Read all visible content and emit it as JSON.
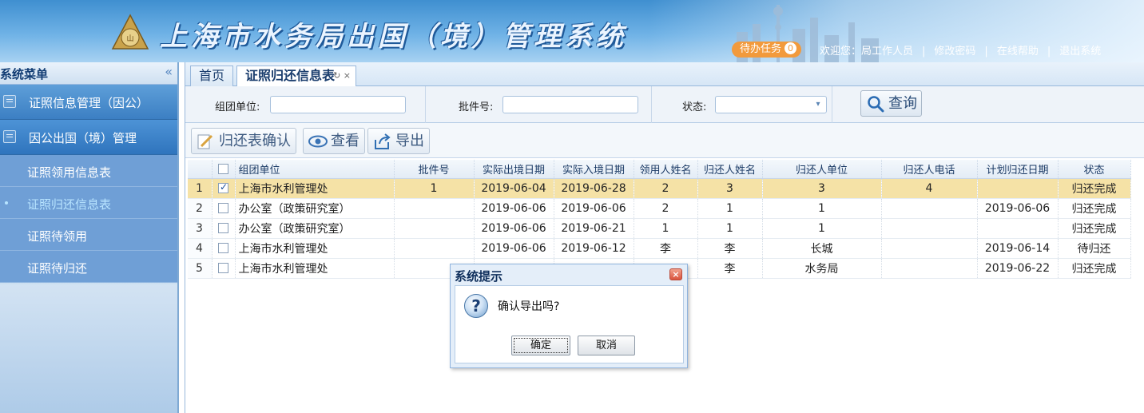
{
  "header": {
    "title": "上海市水务局出国（境）管理系统",
    "todo_label": "待办任务",
    "todo_count": "0",
    "welcome": "欢迎您：局工作人员",
    "change_password": "修改密码",
    "help": "在线帮助",
    "logout": "退出系统",
    "sep": "|"
  },
  "sidebar": {
    "title": "系统菜单",
    "collapse_icon": "«",
    "groups": [
      {
        "label": "证照信息管理（因公）"
      },
      {
        "label": "因公出国（境）管理"
      }
    ],
    "items": [
      {
        "label": "证照领用信息表"
      },
      {
        "label": "证照归还信息表"
      },
      {
        "label": "证照待领用"
      },
      {
        "label": "证照待归还"
      }
    ]
  },
  "tabs": {
    "home": "首页",
    "active": "证照归还信息表",
    "tools": "↻ ×"
  },
  "filter": {
    "org_label": "组团单位:",
    "batch_label": "批件号:",
    "status_label": "状态:",
    "query_label": "查询"
  },
  "toolbar": {
    "confirm_label": "归还表确认",
    "view_label": "查看",
    "export_label": "导出"
  },
  "table": {
    "headers": [
      "组团单位",
      "批件号",
      "实际出境日期",
      "实际入境日期",
      "领用人姓名",
      "归还人姓名",
      "归还人单位",
      "归还人电话",
      "计划归还日期",
      "状态"
    ],
    "rows": [
      {
        "n": "1",
        "checked": true,
        "org": "上海市水利管理处",
        "batch": "1",
        "out": "2019-06-04",
        "in": "2019-06-28",
        "receiver": "2",
        "returner": "3",
        "ret_org": "3",
        "phone": "4",
        "plan": "",
        "status": "归还完成"
      },
      {
        "n": "2",
        "checked": false,
        "org": "办公室（政策研究室）",
        "batch": "",
        "out": "2019-06-06",
        "in": "2019-06-06",
        "receiver": "2",
        "returner": "1",
        "ret_org": "1",
        "phone": "",
        "plan": "2019-06-06",
        "status": "归还完成"
      },
      {
        "n": "3",
        "checked": false,
        "org": "办公室（政策研究室）",
        "batch": "",
        "out": "2019-06-06",
        "in": "2019-06-21",
        "receiver": "1",
        "returner": "1",
        "ret_org": "1",
        "phone": "",
        "plan": "",
        "status": "归还完成"
      },
      {
        "n": "4",
        "checked": false,
        "org": "上海市水利管理处",
        "batch": "",
        "out": "2019-06-06",
        "in": "2019-06-12",
        "receiver": "李",
        "returner": "李",
        "ret_org": "长城",
        "phone": "",
        "plan": "2019-06-14",
        "status": "待归还"
      },
      {
        "n": "5",
        "checked": false,
        "org": "上海市水利管理处",
        "batch": "",
        "out": "",
        "in": "",
        "receiver": "",
        "returner": "李",
        "ret_org": "水务局",
        "phone": "",
        "plan": "2019-06-22",
        "status": "归还完成"
      }
    ]
  },
  "dialog": {
    "title": "系统提示",
    "close": "×",
    "icon": "?",
    "message": "确认导出吗?",
    "ok": "确定",
    "cancel": "取消"
  }
}
